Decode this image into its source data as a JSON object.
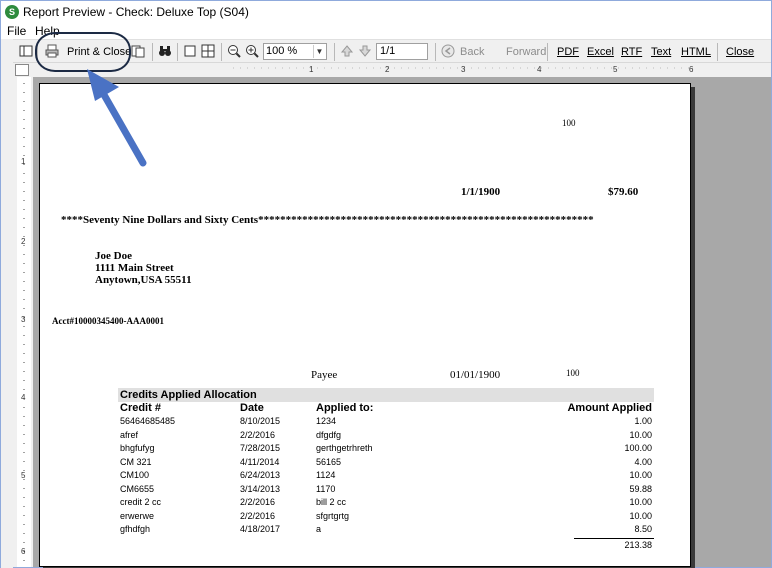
{
  "window": {
    "title": "Report Preview - Check: Deluxe Top (S04)"
  },
  "menu": {
    "file": "File",
    "help": "Help"
  },
  "toolbar": {
    "print_close": "Print & Close",
    "zoom": "100 %",
    "page": "1/1",
    "back": "Back",
    "forward": "Forward",
    "pdf": "PDF",
    "excel": "Excel",
    "rtf": "RTF",
    "text": "Text",
    "html": "HTML",
    "close": "Close"
  },
  "ruler": {
    "h": [
      "1",
      "2",
      "3",
      "4",
      "5",
      "6"
    ],
    "v": [
      "1",
      "2",
      "3",
      "4",
      "5",
      "6"
    ]
  },
  "check": {
    "check_number": "100",
    "date": "1/1/1900",
    "amount": "$79.60",
    "amount_words": "****Seventy Nine Dollars and Sixty  Cents*************************************************************",
    "payee_name": "Joe Doe",
    "payee_street": "1111 Main Street",
    "payee_city": "Anytown,USA 55511",
    "account": "Acct#10000345400-AAA0001",
    "stub_payee": "Payee",
    "stub_date": "01/01/1900",
    "stub_check_number": "100"
  },
  "credits": {
    "title": "Credits Applied Allocation",
    "headers": [
      "Credit #",
      "Date",
      "Applied to:",
      "Amount Applied"
    ],
    "rows": [
      [
        "56464685485",
        "8/10/2015",
        "1234",
        "1.00"
      ],
      [
        "afref",
        "2/2/2016",
        "dfgdfg",
        "10.00"
      ],
      [
        "bhgfufyg",
        "7/28/2015",
        "gerthgetrhreth",
        "100.00"
      ],
      [
        "CM 321",
        "4/11/2014",
        "56165",
        "4.00"
      ],
      [
        "CM100",
        "6/24/2013",
        "1124",
        "10.00"
      ],
      [
        "CM6655",
        "3/14/2013",
        "1170",
        "59.88"
      ],
      [
        "credit 2 cc",
        "2/2/2016",
        "bill 2 cc",
        "10.00"
      ],
      [
        "erwerwe",
        "2/2/2016",
        "sfgrtgrtg",
        "10.00"
      ],
      [
        "gfhdfgh",
        "4/18/2017",
        "a",
        "8.50"
      ]
    ],
    "total": "213.38"
  },
  "icons": [
    "toggle-panel-icon",
    "printer-icon",
    "copy-pages-icon",
    "binoculars-icon",
    "single-page-icon",
    "multi-page-icon",
    "zoom-out-icon",
    "zoom-in-icon",
    "first-page-icon",
    "prev-page-icon",
    "back-arrow-icon"
  ],
  "annotation": {
    "circle_color": "#1c2a44",
    "arrow_color": "#4a72c4"
  }
}
